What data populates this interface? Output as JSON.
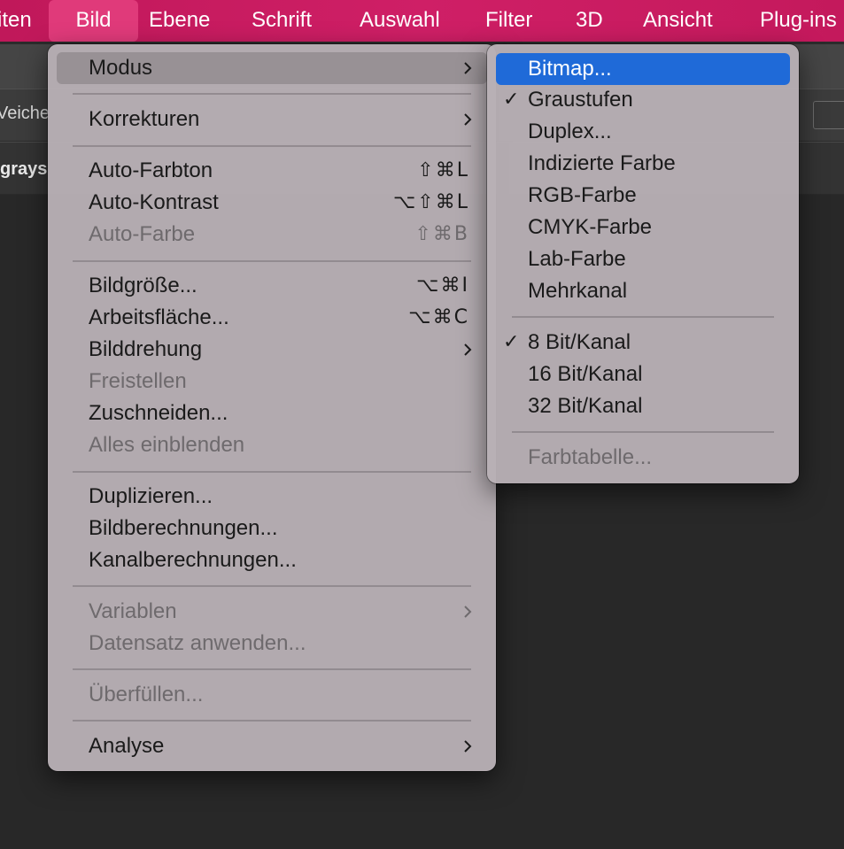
{
  "menubar": {
    "items": [
      "iten",
      "Bild",
      "Ebene",
      "Schrift",
      "Auswahl",
      "Filter",
      "3D",
      "Ansicht",
      "Plug-ins"
    ],
    "active": "Bild"
  },
  "background": {
    "options_label": "Veiche",
    "tab_label": "grays"
  },
  "bild_menu": {
    "items": [
      {
        "label": "Modus",
        "submenu": true,
        "state": "hover"
      },
      {
        "label": "Korrekturen",
        "submenu": true
      },
      {
        "label": "Auto-Farbton",
        "shortcut": "⇧⌘L"
      },
      {
        "label": "Auto-Kontrast",
        "shortcut": "⌥⇧⌘L"
      },
      {
        "label": "Auto-Farbe",
        "shortcut": "⇧⌘B",
        "disabled": true
      },
      {
        "label": "Bildgröße...",
        "shortcut": "⌥⌘I"
      },
      {
        "label": "Arbeitsfläche...",
        "shortcut": "⌥⌘C"
      },
      {
        "label": "Bilddrehung",
        "submenu": true
      },
      {
        "label": "Freistellen",
        "disabled": true
      },
      {
        "label": "Zuschneiden..."
      },
      {
        "label": "Alles einblenden",
        "disabled": true
      },
      {
        "label": "Duplizieren..."
      },
      {
        "label": "Bildberechnungen..."
      },
      {
        "label": "Kanalberechnungen..."
      },
      {
        "label": "Variablen",
        "submenu": true,
        "disabled": true
      },
      {
        "label": "Datensatz anwenden...",
        "disabled": true
      },
      {
        "label": "Überfüllen...",
        "disabled": true
      },
      {
        "label": "Analyse",
        "submenu": true
      }
    ]
  },
  "modus_menu": {
    "items": [
      {
        "label": "Bitmap...",
        "state": "selected"
      },
      {
        "label": "Graustufen",
        "checked": true
      },
      {
        "label": "Duplex..."
      },
      {
        "label": "Indizierte Farbe"
      },
      {
        "label": "RGB-Farbe"
      },
      {
        "label": "CMYK-Farbe"
      },
      {
        "label": "Lab-Farbe"
      },
      {
        "label": "Mehrkanal"
      },
      {
        "label": "8 Bit/Kanal",
        "checked": true
      },
      {
        "label": "16 Bit/Kanal"
      },
      {
        "label": "32 Bit/Kanal"
      },
      {
        "label": "Farbtabelle...",
        "disabled": true
      }
    ]
  },
  "glyphs": {
    "check": "✓"
  },
  "colors": {
    "menubar": "#c8195f",
    "highlight": "#1f6ad8",
    "menu_bg": "#b8b0b5"
  }
}
